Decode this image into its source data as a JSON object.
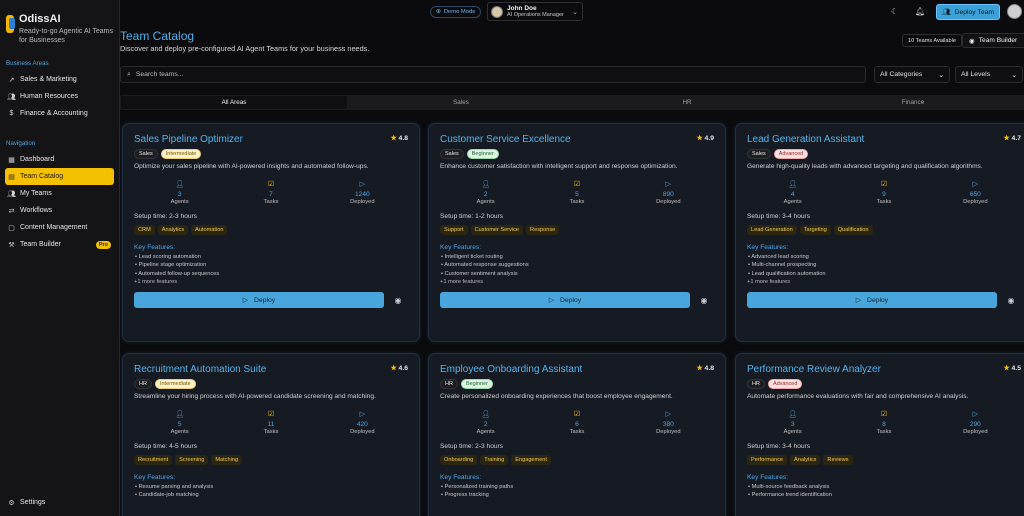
{
  "brand": {
    "title": "OdissAI",
    "subtitle": "Ready-to-go Agentic AI Teams for Businesses"
  },
  "sidebar": {
    "business_heading": "Business Areas",
    "business_items": [
      {
        "label": "Sales & Marketing",
        "icon": "trend-icon"
      },
      {
        "label": "Human Resources",
        "icon": "users-icon"
      },
      {
        "label": "Finance & Accounting",
        "icon": "dollar-icon"
      }
    ],
    "nav_heading": "Navigation",
    "nav_items": [
      {
        "label": "Dashboard",
        "icon": "dashboard-icon"
      },
      {
        "label": "Team Catalog",
        "icon": "catalog-icon",
        "active": true
      },
      {
        "label": "My Teams",
        "icon": "users-icon"
      },
      {
        "label": "Workflows",
        "icon": "workflow-icon"
      },
      {
        "label": "Content Management",
        "icon": "content-icon"
      },
      {
        "label": "Team Builder",
        "icon": "builder-icon",
        "badge": "Pro"
      }
    ],
    "settings": "Settings"
  },
  "topbar": {
    "demo_mode": "Demo Mode",
    "user_name": "John Doe",
    "user_role": "AI Operations Manager",
    "deploy_team": "Deploy Team"
  },
  "header": {
    "title": "Team Catalog",
    "subtitle": "Discover and deploy pre-configured AI Agent Teams for your business needs.",
    "teams_available": "10 Teams Available",
    "team_builder": "Team Builder"
  },
  "search": {
    "placeholder": "Search teams..."
  },
  "filters": {
    "category": "All Categories",
    "level": "All Levels"
  },
  "tabs": [
    "All Areas",
    "Sales",
    "HR",
    "Finance"
  ],
  "labels": {
    "agents": "Agents",
    "tasks": "Tasks",
    "deployed": "Deployed",
    "key_features": "Key Features:",
    "deploy": "Deploy"
  },
  "cards": [
    {
      "title": "Sales Pipeline Optimizer",
      "rating": "4.8",
      "area": "Sales",
      "level": "Intermediate",
      "level_class": "lvl-int",
      "description": "Optimize your sales pipeline with AI-powered insights and automated follow-ups.",
      "agents": "3",
      "tasks": "7",
      "deployed": "1240",
      "setup": "Setup time: 2-3 hours",
      "tags": [
        "CRM",
        "Analytics",
        "Automation"
      ],
      "features": [
        "Lead scoring automation",
        "Pipeline stage optimization",
        "Automated follow-up sequences"
      ],
      "more": "+1 more features"
    },
    {
      "title": "Customer Service Excellence",
      "rating": "4.9",
      "area": "Sales",
      "level": "Beginner",
      "level_class": "lvl-beg",
      "description": "Enhance customer satisfaction with intelligent support and response optimization.",
      "agents": "2",
      "tasks": "5",
      "deployed": "890",
      "setup": "Setup time: 1-2 hours",
      "tags": [
        "Support",
        "Customer Service",
        "Response"
      ],
      "features": [
        "Intelligent ticket routing",
        "Automated response suggestions",
        "Customer sentiment analysis"
      ],
      "more": "+1 more features"
    },
    {
      "title": "Lead Generation Assistant",
      "rating": "4.7",
      "area": "Sales",
      "level": "Advanced",
      "level_class": "lvl-adv",
      "description": "Generate high-quality leads with advanced targeting and qualification algorithms.",
      "agents": "4",
      "tasks": "9",
      "deployed": "650",
      "setup": "Setup time: 3-4 hours",
      "tags": [
        "Lead Generation",
        "Targeting",
        "Qualification"
      ],
      "features": [
        "Advanced lead scoring",
        "Multi-channel prospecting",
        "Lead qualification automation"
      ],
      "more": "+1 more features"
    },
    {
      "title": "Recruitment Automation Suite",
      "rating": "4.6",
      "area": "HR",
      "level": "Intermediate",
      "level_class": "lvl-int",
      "description": "Streamline your hiring process with AI-powered candidate screening and matching.",
      "agents": "5",
      "tasks": "11",
      "deployed": "420",
      "setup": "Setup time: 4-5 hours",
      "tags": [
        "Recruitment",
        "Screening",
        "Matching"
      ],
      "features": [
        "Resume parsing and analysis",
        "Candidate-job matching"
      ],
      "more": ""
    },
    {
      "title": "Employee Onboarding Assistant",
      "rating": "4.8",
      "area": "HR",
      "level": "Beginner",
      "level_class": "lvl-beg",
      "description": "Create personalized onboarding experiences that boost employee engagement.",
      "agents": "2",
      "tasks": "6",
      "deployed": "380",
      "setup": "Setup time: 2-3 hours",
      "tags": [
        "Onboarding",
        "Training",
        "Engagement"
      ],
      "features": [
        "Personalized training paths",
        "Progress tracking"
      ],
      "more": ""
    },
    {
      "title": "Performance Review Analyzer",
      "rating": "4.5",
      "area": "HR",
      "level": "Advanced",
      "level_class": "lvl-adv",
      "description": "Automate performance evaluations with fair and comprehensive AI analysis.",
      "agents": "3",
      "tasks": "8",
      "deployed": "290",
      "setup": "Setup time: 3-4 hours",
      "tags": [
        "Performance",
        "Analytics",
        "Reviews"
      ],
      "features": [
        "Multi-source feedback analysis",
        "Performance trend identification"
      ],
      "more": ""
    }
  ]
}
